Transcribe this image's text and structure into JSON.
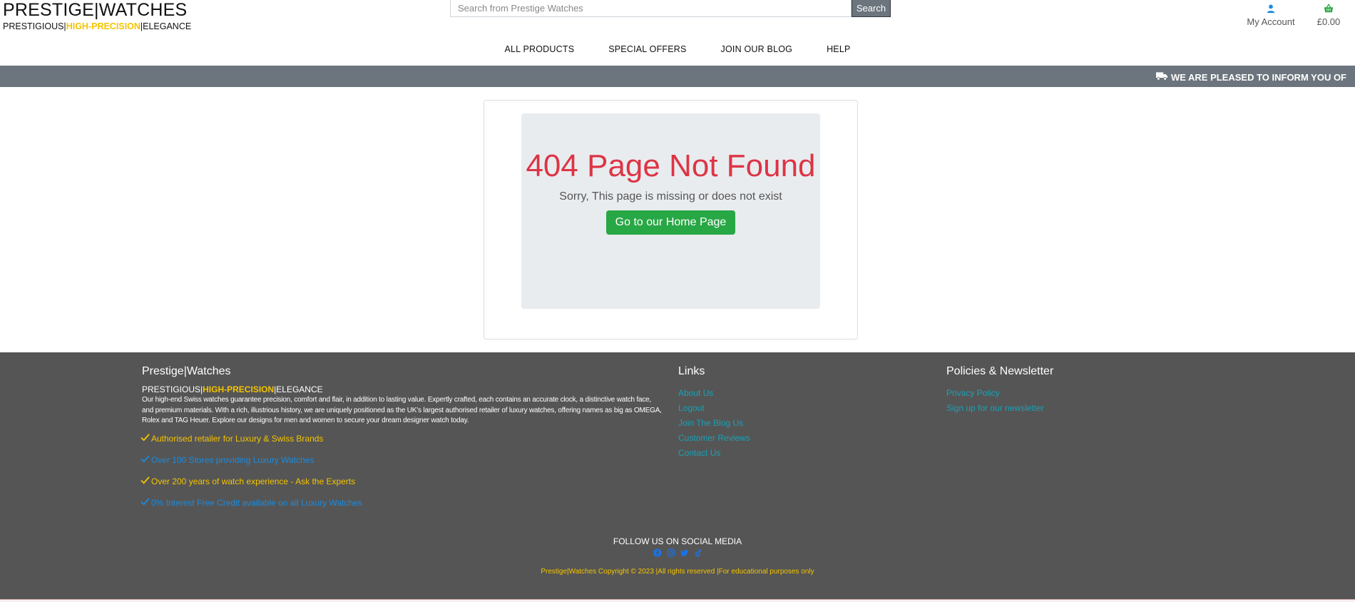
{
  "header": {
    "brand_title": "PRESTIGE|WATCHES",
    "tagline_part1": "PRESTIGIOUS|",
    "tagline_highlight": "HIGH-PRECISION",
    "tagline_part2": "|ELEGANCE",
    "search_placeholder": "Search from Prestige Watches",
    "search_button": "Search",
    "account_label": "My Account",
    "cart_total": "£0.00",
    "account_icon": "user-icon",
    "cart_icon": "basket-icon"
  },
  "nav": {
    "items": [
      "ALL PRODUCTS",
      "SPECIAL OFFERS",
      "JOIN OUR BLOG",
      "HELP"
    ]
  },
  "banner": {
    "icon": "truck-icon",
    "text": "WE ARE PLEASED TO INFORM YOU OF"
  },
  "main": {
    "title": "404 Page Not Found",
    "subtitle": "Sorry, This page is missing or does not exist",
    "button": "Go to our Home Page"
  },
  "footer": {
    "brand": "Prestige|Watches",
    "tagline_part1": "PRESTIGIOUS|",
    "tagline_highlight": "HIGH-PRECISION",
    "tagline_part2": "|ELEGANCE",
    "description": "Our high-end Swiss watches guarantee precision, comfort and flair, in addition to lasting value. Expertly crafted, each contains an accurate clock, a distinctive watch face, and premium materials. With a rich, illustrious history, we are uniquely positioned as the UK's largest authorised retailer of luxury watches, offering names as big as OMEGA, Rolex and TAG Heuer. Explore our designs for men and women to secure your dream designer watch today.",
    "features": [
      {
        "text": "Authorised retailer for Luxury & Swiss Brands",
        "color": "yellow"
      },
      {
        "text": "Over 100 Stores providing Luxury Watches",
        "color": "blue"
      },
      {
        "text": "Over 200 years of watch experience - Ask the Experts",
        "color": "yellow"
      },
      {
        "text": "0% Interest Free Credit available on all Luxury Watches",
        "color": "blue"
      }
    ],
    "links_heading": "Links",
    "links": [
      "About Us",
      "Logout",
      "Join The Blog Us",
      "Customer Reviews",
      "Contact Us"
    ],
    "policies_heading": "Policies & Newsletter",
    "policies": [
      "Privacy Policy",
      "Sign up for our newsletter"
    ],
    "follow_label": "FOLLOW US ON SOCIAL MEDIA",
    "socials": [
      "facebook-icon",
      "instagram-icon",
      "twitter-icon",
      "tiktok-icon"
    ],
    "copyright": "Prestige|Watches Copyright © 2023 |All rights reserved |For educational purposes only"
  },
  "colors": {
    "accent_yellow": "#f5c400",
    "error_red": "#dc3545",
    "success_green": "#28a745",
    "link_teal": "#17a2b8",
    "footer_bg": "#555555",
    "banner_bg": "#6c757d"
  }
}
